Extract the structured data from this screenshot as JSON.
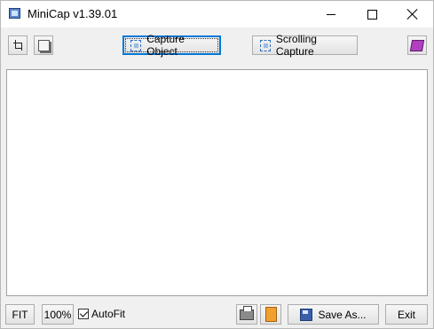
{
  "window": {
    "title": "MiniCap v1.39.01",
    "controls": [
      "minimize-icon",
      "maximize-icon",
      "close-icon"
    ]
  },
  "toolbar": {
    "crop_icon": "crop-icon",
    "shadow_icon": "shadow-icon",
    "capture_object_label": "Capture Object",
    "scrolling_capture_label": "Scrolling Capture",
    "book_icon": "book-icon"
  },
  "statusbar": {
    "fit_label": "FIT",
    "zoom_label": "100%",
    "autofit_label": "AutoFit",
    "autofit_checked": true,
    "print_icon": "printer-icon",
    "clipboard_icon": "clipboard-icon",
    "save_as_label": "Save As...",
    "exit_label": "Exit"
  },
  "colors": {
    "focus_border": "#0078d7",
    "window_bg": "#f0f0f0",
    "canvas_bg": "#ffffff"
  }
}
